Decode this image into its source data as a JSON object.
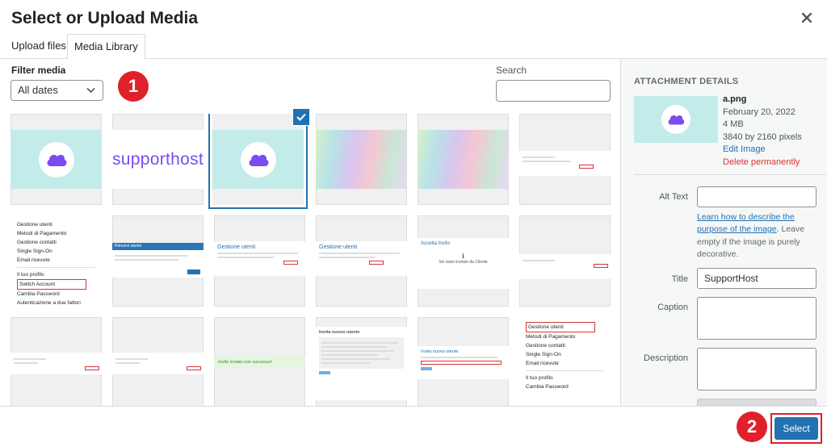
{
  "modal": {
    "title": "Select or Upload Media",
    "close_icon": "close-icon"
  },
  "tabs": [
    {
      "label": "Upload files",
      "active": false
    },
    {
      "label": "Media Library",
      "active": true
    }
  ],
  "toolbar": {
    "filter_label": "Filter media",
    "filter_value": "All dates",
    "search_label": "Search",
    "search_value": ""
  },
  "badges": {
    "step1": "1",
    "step2": "2"
  },
  "grid": {
    "items": [
      {
        "kind": "cloud-logo"
      },
      {
        "kind": "wordmark",
        "text": "supporthost"
      },
      {
        "kind": "cloud-logo",
        "selected": true
      },
      {
        "kind": "gradient"
      },
      {
        "kind": "gradient"
      },
      {
        "kind": "screenshot"
      },
      {
        "kind": "menu-screenshot",
        "lines": [
          "Gestione utenti",
          "Metodi di Pagamento",
          "Gestione contatti",
          "Single Sign-On",
          "Email ricevute",
          "",
          "Il tuo profilo",
          "Switch Account",
          "Cambia Password",
          "Autenticazione a due fattori"
        ],
        "highlight": "Switch Account"
      },
      {
        "kind": "screenshot-dialog",
        "header": "Rimuovi utente"
      },
      {
        "kind": "screenshot-table",
        "heading": "Gestione utenti"
      },
      {
        "kind": "screenshot-table",
        "heading": "Gestione utenti"
      },
      {
        "kind": "screenshot-invite",
        "heading": "Accetta Invito",
        "text": "Sei stato invitato da Cliente"
      },
      {
        "kind": "screenshot"
      },
      {
        "kind": "screenshot"
      },
      {
        "kind": "screenshot"
      },
      {
        "kind": "screenshot-success",
        "text": "Invito inviato con successo!"
      },
      {
        "kind": "screenshot-form",
        "heading": "Invita nuovo utente"
      },
      {
        "kind": "screenshot-form",
        "heading": "Invita nuovo utente"
      },
      {
        "kind": "menu-screenshot",
        "lines": [
          "Gestione utenti",
          "Metodi di Pagamento",
          "Gestione contatti",
          "Single Sign-On",
          "Email ricevute",
          "",
          "Il tuo profilo",
          "Cambia Password"
        ],
        "highlight": "Gestione utenti"
      }
    ]
  },
  "attachment": {
    "heading": "ATTACHMENT DETAILS",
    "filename": "a.png",
    "date": "February 20, 2022",
    "size": "4 MB",
    "dimensions": "3840 by 2160 pixels",
    "edit_link": "Edit Image",
    "delete_link": "Delete permanently",
    "alt_label": "Alt Text",
    "alt_value": "",
    "help_link": "Learn how to describe the purpose of the image",
    "help_rest": ". Leave empty if the image is purely decorative.",
    "title_label": "Title",
    "title_value": "SupportHost",
    "caption_label": "Caption",
    "description_label": "Description"
  },
  "footer": {
    "select_label": "Select"
  },
  "colors": {
    "accent": "#2271b1",
    "danger": "#d63638",
    "badge": "#e0202a",
    "logo": "#7a4cf0",
    "teal": "#c2ebe9"
  }
}
